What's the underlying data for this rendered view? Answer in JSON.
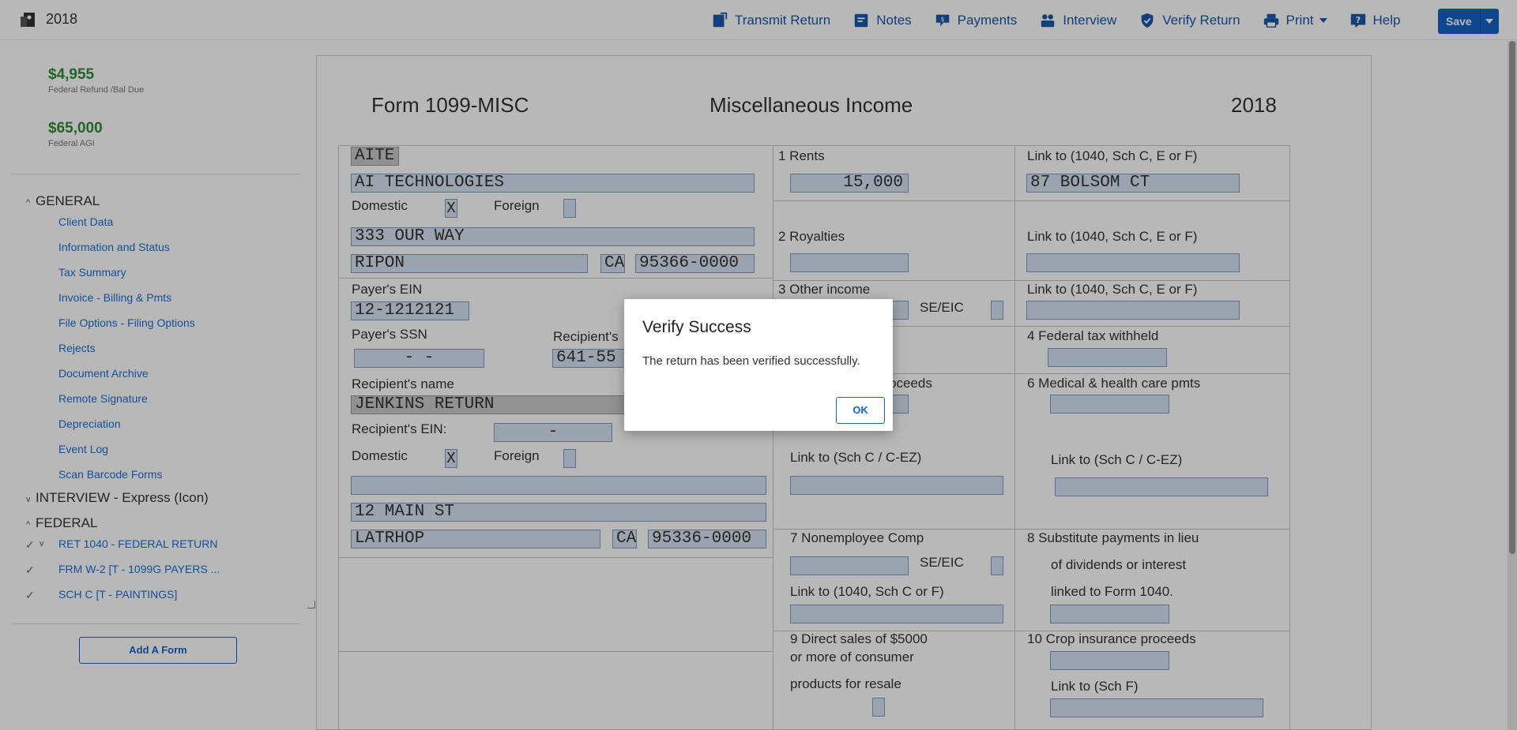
{
  "app": {
    "year": "2018"
  },
  "nav": {
    "transmit": "Transmit Return",
    "notes": "Notes",
    "payments": "Payments",
    "interview": "Interview",
    "verify": "Verify Return",
    "print": "Print",
    "help": "Help",
    "save": "Save"
  },
  "summary": {
    "refund_amount": "$4,955",
    "refund_label": "Federal Refund /Bal Due",
    "agi_amount": "$65,000",
    "agi_label": "Federal AGI"
  },
  "sidebar": {
    "general_label": "GENERAL",
    "general_items": [
      "Client Data",
      "Information and Status",
      "Tax Summary",
      "Invoice - Billing & Pmts",
      "File Options - Filing Options",
      "Rejects",
      "Document Archive",
      "Remote Signature",
      "Depreciation",
      "Event Log",
      "Scan Barcode Forms"
    ],
    "interview_label": "INTERVIEW - Express (Icon)",
    "federal_label": "FEDERAL",
    "federal_items": [
      "RET 1040 - FEDERAL RETURN",
      "FRM W-2 [T - 1099G PAYERS ...",
      "SCH C [T - PAINTINGS]"
    ],
    "add_form": "Add A Form"
  },
  "form": {
    "form_name": "Form 1099-MISC",
    "form_title": "Miscellaneous Income",
    "form_year": "2018",
    "payer_short": "AITE",
    "payer_name": "AI TECHNOLOGIES",
    "domestic_label": "Domestic",
    "foreign_label": "Foreign",
    "payer_domestic": "X",
    "payer_address": "333 OUR WAY",
    "payer_city": "RIPON",
    "payer_state": "CA",
    "payer_zip": "95366-0000",
    "payer_ein_label": "Payer's EIN",
    "payer_ein": "12-1212121",
    "payer_ssn_label": "Payer's SSN",
    "payer_ssn": " -  - ",
    "recipient_id_label": "Recipient's",
    "recipient_id": "641-55",
    "recipient_name_label": "Recipient's name",
    "recipient_name": "JENKINS RETURN",
    "recipient_ein_label": "Recipient's EIN:",
    "recipient_ein": "-",
    "recipient_domestic": "X",
    "recipient_address": "12 MAIN ST",
    "recipient_city": "LATRHOP",
    "recipient_state": "CA",
    "recipient_zip": "95336-0000",
    "rents_label": "1 Rents",
    "rents_value": "15,000",
    "link_1040_label": "Link to (1040, Sch C, E or F)",
    "rents_link_value": "87 BOLSOM CT",
    "royalties_label": "2 Royalties",
    "other_income_label": "3 Other income",
    "se_eic_label": "SE/EIC",
    "fed_tax_label": "4  Federal tax withheld",
    "proceeds_label": "oceeds",
    "medical_label": "6  Medical & health care pmts",
    "link_schc_label": "Link to (Sch C / C-EZ)",
    "nonemployee_label": "7 Nonemployee Comp",
    "link_1040_cf_label": "Link to (1040, Sch C or F)",
    "substitute_label_1": "8  Substitute payments in lieu",
    "substitute_label_2": "of dividends or interest",
    "substitute_label_3": "linked to Form 1040.",
    "direct_sales_label_1": "9 Direct sales of $5000",
    "direct_sales_label_2": "or more of consumer",
    "direct_sales_label_3": "products for resale",
    "crop_label": "10 Crop insurance proceeds",
    "link_schf_label": "Link to (Sch F)"
  },
  "modal": {
    "title": "Verify Success",
    "message": "The return has been verified successfully.",
    "ok": "OK"
  }
}
